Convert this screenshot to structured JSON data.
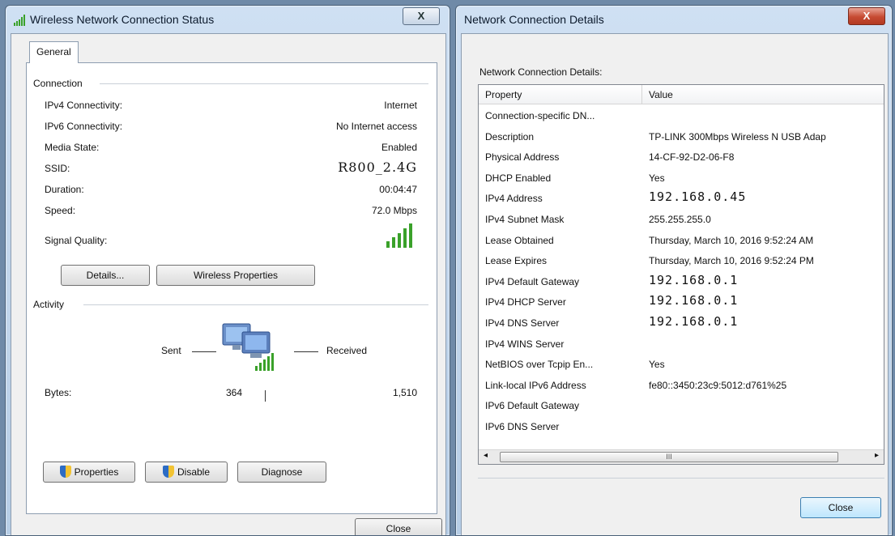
{
  "left_window": {
    "title": "Wireless Network Connection Status",
    "close_glyph": "X",
    "tab": "General",
    "connection": {
      "heading": "Connection",
      "rows": [
        {
          "label": "IPv4 Connectivity:",
          "value": "Internet"
        },
        {
          "label": "IPv6 Connectivity:",
          "value": "No Internet access"
        },
        {
          "label": "Media State:",
          "value": "Enabled"
        },
        {
          "label": "SSID:",
          "value": "R800_2.4G"
        },
        {
          "label": "Duration:",
          "value": "00:04:47"
        },
        {
          "label": "Speed:",
          "value": "72.0 Mbps"
        }
      ],
      "signal_label": "Signal Quality:",
      "signal_bars_lit": 5,
      "signal_bars_total": 5,
      "details_button": "Details...",
      "wireless_properties_button": "Wireless Properties"
    },
    "activity": {
      "heading": "Activity",
      "sent_label": "Sent",
      "received_label": "Received",
      "bytes_label": "Bytes:",
      "bytes_sent": "364",
      "bytes_received": "1,510"
    },
    "buttons": {
      "properties": "Properties",
      "disable": "Disable",
      "diagnose": "Diagnose"
    },
    "close_button": "Close"
  },
  "right_window": {
    "title": "Network Connection Details",
    "close_glyph": "X",
    "label": "Network Connection Details:",
    "columns": [
      "Property",
      "Value"
    ],
    "rows": [
      {
        "property": "Connection-specific DN...",
        "value": ""
      },
      {
        "property": "Description",
        "value": "TP-LINK 300Mbps Wireless N USB Adap"
      },
      {
        "property": "Physical Address",
        "value": "14-CF-92-D2-06-F8"
      },
      {
        "property": "DHCP Enabled",
        "value": "Yes"
      },
      {
        "property": "IPv4 Address",
        "value": "192.168.0.45"
      },
      {
        "property": "IPv4 Subnet Mask",
        "value": "255.255.255.0"
      },
      {
        "property": "Lease Obtained",
        "value": "Thursday, March 10, 2016 9:52:24 AM"
      },
      {
        "property": "Lease Expires",
        "value": "Thursday, March 10, 2016 9:52:24 PM"
      },
      {
        "property": "IPv4 Default Gateway",
        "value": "192.168.0.1"
      },
      {
        "property": "IPv4 DHCP Server",
        "value": "192.168.0.1"
      },
      {
        "property": "IPv4 DNS Server",
        "value": "192.168.0.1"
      },
      {
        "property": "IPv4 WINS Server",
        "value": ""
      },
      {
        "property": "NetBIOS over Tcpip En...",
        "value": "Yes"
      },
      {
        "property": "Link-local IPv6 Address",
        "value": "fe80::3450:23c9:5012:d761%25"
      },
      {
        "property": "IPv6 Default Gateway",
        "value": ""
      },
      {
        "property": "IPv6 DNS Server",
        "value": ""
      }
    ],
    "scroll_thumb_glyph": "III",
    "close_button": "Close"
  },
  "colors": {
    "titlebar": "#cfe0f3",
    "close_red": "#c64a32",
    "signal_green": "#3aa12a"
  }
}
